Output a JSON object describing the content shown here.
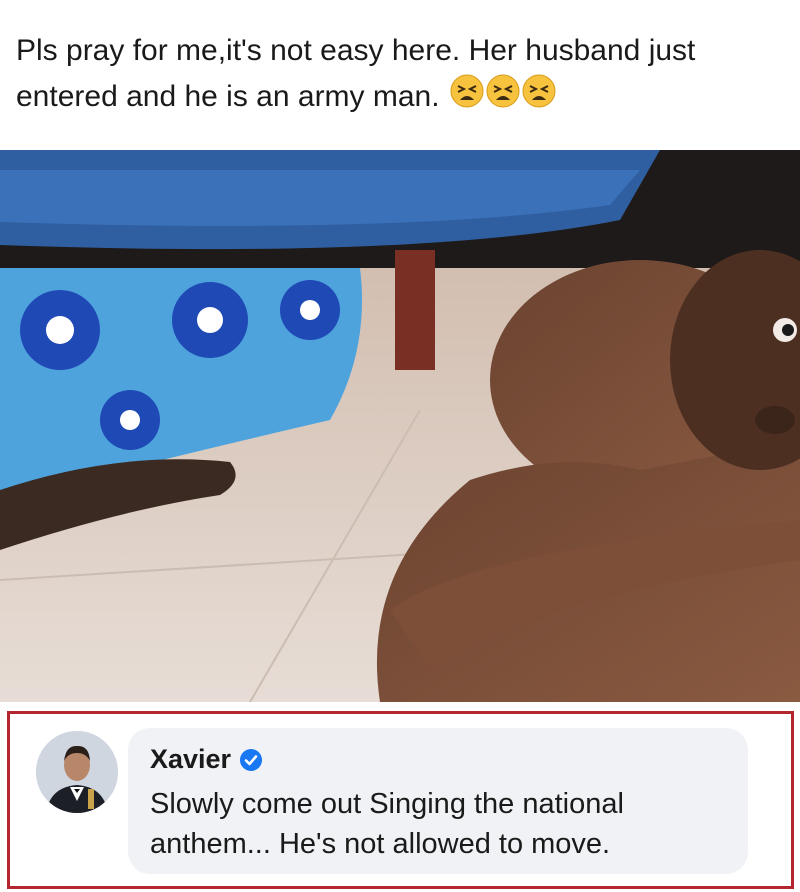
{
  "post": {
    "caption": "Pls pray for me,it's not easy here. Her husband just entered and he is an army man.",
    "emoji_icons": [
      "tired-face-emoji",
      "tired-face-emoji",
      "tired-face-emoji"
    ]
  },
  "comment": {
    "author": "Xavier",
    "verified": true,
    "text": "Slowly come out Singing the national anthem... He's not allowed to move."
  },
  "colors": {
    "frame_border": "#b3262e",
    "bubble_bg": "#f0f2f5",
    "verified_blue": "#1877f2"
  }
}
